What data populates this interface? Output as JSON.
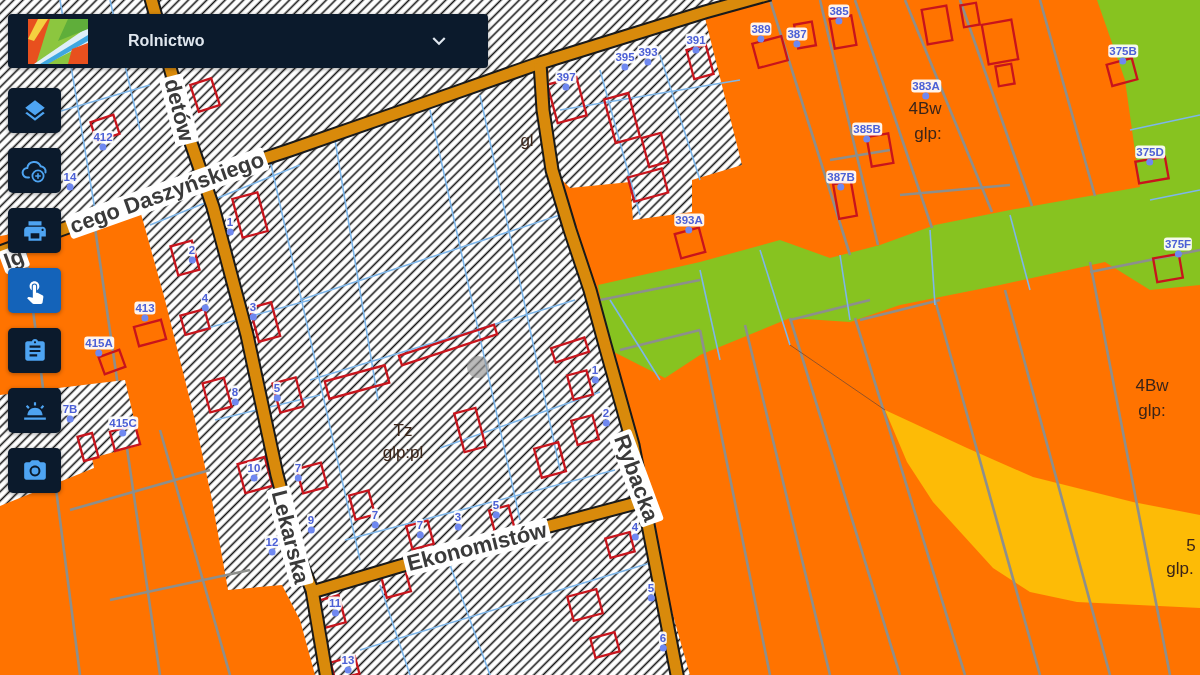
{
  "header": {
    "title": "Rolnictwo"
  },
  "toolbar": [
    {
      "selected": false
    },
    {
      "selected": false
    },
    {
      "selected": false
    },
    {
      "selected": true
    },
    {
      "selected": false
    },
    {
      "selected": false
    },
    {
      "selected": false
    }
  ],
  "map": {
    "streets": [
      "detów",
      "Ig",
      "cego Daszyńskiego",
      "Lekarska",
      "Ekonomistów",
      "Rybacka"
    ],
    "zone_labels": [
      "gl",
      "4Bw",
      "glp:",
      "Tz",
      "glp:pl",
      "4Bw",
      "glp:",
      "5",
      "glp."
    ],
    "house_numbers": [
      "385",
      "391",
      "389",
      "387",
      "395",
      "393",
      "375B",
      "397",
      "383A",
      "412",
      "385B",
      "375D",
      "14",
      "387B",
      "1",
      "393A",
      "2",
      "375F",
      "413",
      "4",
      "3",
      "415A",
      "1",
      "8",
      "5",
      "7B",
      "415C",
      "2",
      "10",
      "7",
      "9",
      "7",
      "7",
      "3",
      "5",
      "4",
      "12",
      "5",
      "11",
      "6",
      "13"
    ]
  }
}
